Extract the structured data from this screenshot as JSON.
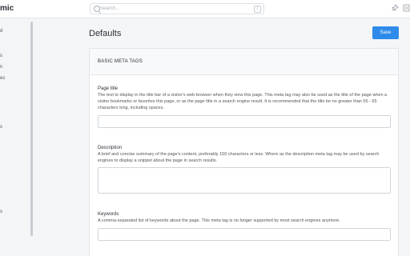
{
  "app": {
    "brand": "mic"
  },
  "search": {
    "placeholder": "Search...",
    "shortcut": "/"
  },
  "header_icons": [
    "pin-icon",
    "document-icon"
  ],
  "sidebar": {
    "items": [
      {
        "label": "d"
      },
      {
        "label": "s"
      },
      {
        "label": "n"
      },
      {
        "label": "es"
      },
      {
        "label": "s"
      },
      {
        "label": "s"
      }
    ]
  },
  "page": {
    "title": "Defaults",
    "save_label": "Save"
  },
  "card": {
    "title": "BASIC META TAGS"
  },
  "fields": {
    "page_title": {
      "label": "Page title",
      "description": "The text to display in the title bar of a visitor's web browser when they view this page. This meta tag may also be used as the title of the page when a visitor bookmarks or favorites this page, or as the page title in a search engine result. It is recommended that the title be no greater than 55 - 65 characters long, including spaces.",
      "value": ""
    },
    "description": {
      "label": "Description",
      "description": "A brief and concise summary of the page's content, preferably 150 characters or less. Where as the description meta tag may be used by search engines to display a snippet about the page in search results.",
      "value": ""
    },
    "keywords": {
      "label": "Keywords",
      "description_before": "A comma-separated list of keywords about the page. This meta tag is ",
      "description_em": "no longer",
      "description_after": " supported by most search engines anymore.",
      "value": ""
    }
  }
}
